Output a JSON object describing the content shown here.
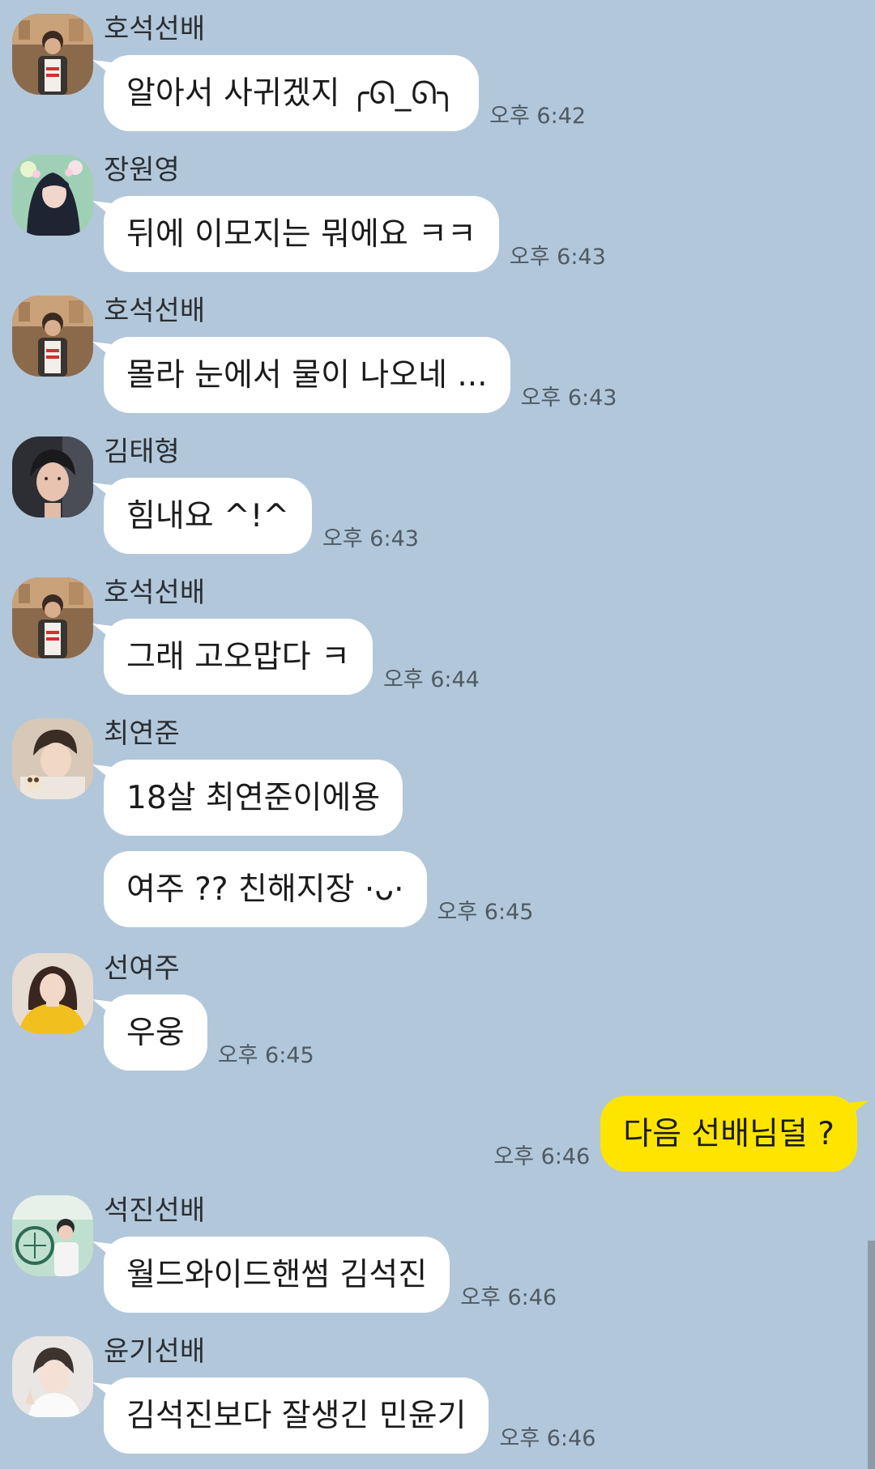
{
  "messages": [
    {
      "sender": "호석선배",
      "texts": [
        "알아서 사귀겠지 ╭ᘏ_ᘏ╮"
      ],
      "time": "오후 6:42"
    },
    {
      "sender": "장원영",
      "texts": [
        "뒤에 이모지는 뭐에요 ㅋㅋ"
      ],
      "time": "오후 6:43"
    },
    {
      "sender": "호석선배",
      "texts": [
        "몰라 눈에서 물이 나오네 ..."
      ],
      "time": "오후 6:43"
    },
    {
      "sender": "김태형",
      "texts": [
        "힘내요 ^!^"
      ],
      "time": "오후 6:43"
    },
    {
      "sender": "호석선배",
      "texts": [
        "그래 고오맙다 ㅋ"
      ],
      "time": "오후 6:44"
    },
    {
      "sender": "최연준",
      "texts": [
        "18살 최연준이에용",
        "여주 ?? 친해지장 ·ᴗ·"
      ],
      "time": "오후 6:45"
    },
    {
      "sender": "선여주",
      "texts": [
        "우웅"
      ],
      "time": "오후 6:45"
    },
    {
      "mine": true,
      "texts": [
        "다음 선배님덜 ?"
      ],
      "time": "오후 6:46"
    },
    {
      "sender": "석진선배",
      "texts": [
        "월드와이드핸썸 김석진"
      ],
      "time": "오후 6:46"
    },
    {
      "sender": "윤기선배",
      "texts": [
        "김석진보다 잘생긴 민윤기"
      ],
      "time": "오후 6:46"
    }
  ],
  "colors": {
    "background": "#b2c7da",
    "bubble_other": "#ffffff",
    "bubble_mine": "#fee500"
  }
}
